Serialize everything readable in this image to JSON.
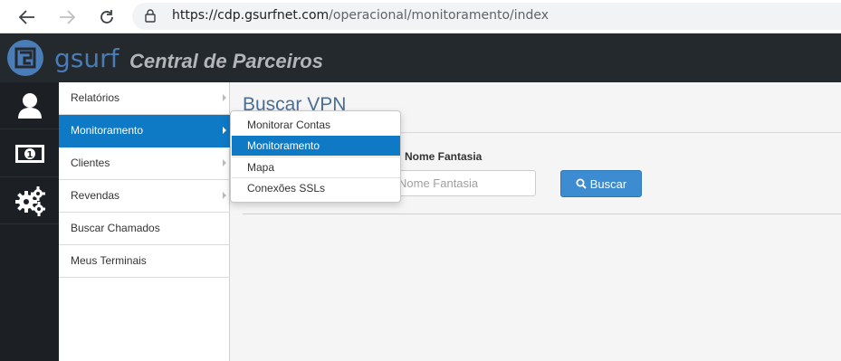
{
  "browser": {
    "url_host": "https://cdp.gsurfnet.com",
    "url_path": "/operacional/monitoramento/index"
  },
  "header": {
    "logo_text": "gsurf",
    "title": "Central de Parceiros"
  },
  "icon_sidebar": [
    "user-icon",
    "money-icon",
    "gears-icon"
  ],
  "menu": {
    "items": [
      {
        "label": "Relatórios",
        "has_submenu": true
      },
      {
        "label": "Monitoramento",
        "has_submenu": true,
        "active": true
      },
      {
        "label": "Clientes",
        "has_submenu": true
      },
      {
        "label": "Revendas",
        "has_submenu": true
      },
      {
        "label": "Buscar Chamados",
        "has_submenu": false
      },
      {
        "label": "Meus Terminais",
        "has_submenu": false
      }
    ]
  },
  "submenu": {
    "items": [
      {
        "label": "Monitorar Contas"
      },
      {
        "label": "Monitoramento",
        "active": true
      },
      {
        "label": "Mapa"
      },
      {
        "label": "Conexões SSLs"
      }
    ]
  },
  "main": {
    "title": "Buscar VPN",
    "field_label": "Nome Fantasia",
    "field_placeholder": "Nome Fantasia",
    "search_button": "Buscar"
  },
  "colors": {
    "accent": "#0e7ac6",
    "button": "#3d8bd0",
    "header_bg": "#24292d",
    "sidebar_bg": "#1c2024"
  }
}
